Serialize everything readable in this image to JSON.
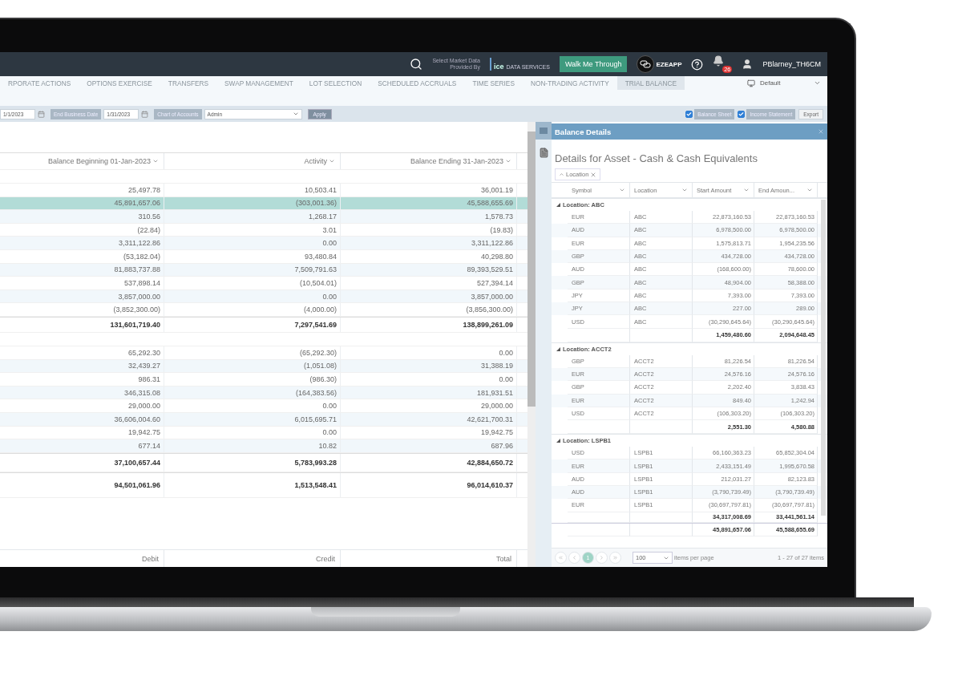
{
  "topbar": {
    "market_note": [
      "Select Market Data",
      "Provided By"
    ],
    "provider_logo": {
      "mark": "ice",
      "text": "DATA SERVICES"
    },
    "walk_button": "Walk Me Through",
    "app_name": "EZEAPP",
    "notifications": "26",
    "user": "PBlarney_TH6CM"
  },
  "tabs": [
    {
      "label": "RPORATE ACTIONS",
      "selected": false
    },
    {
      "label": "OPTIONS EXERCISE",
      "selected": false
    },
    {
      "label": "TRANSFERS",
      "selected": false
    },
    {
      "label": "SWAP MANAGEMENT",
      "selected": false
    },
    {
      "label": "LOT SELECTION",
      "selected": false
    },
    {
      "label": "SCHEDULED ACCRUALS",
      "selected": false
    },
    {
      "label": "TIME SERIES",
      "selected": false
    },
    {
      "label": "NON-TRADING ACTIVITY",
      "selected": false
    },
    {
      "label": "TRIAL BALANCE",
      "selected": true
    }
  ],
  "layout_menu": "Default",
  "filters": {
    "start_date": "1/1/2023",
    "end_label": "End Business Date",
    "end_date": "1/31/2023",
    "chart_label": "Chart of Accounts",
    "chart_value": "Admin",
    "apply": "Apply",
    "toggles": [
      {
        "label": "Balance Sheet",
        "checked": true
      },
      {
        "label": "Income Statement",
        "checked": true
      }
    ],
    "export": "Export"
  },
  "trial_balance": {
    "columns": [
      "Balance Beginning 01-Jan-2023",
      "Activity",
      "Balance Ending 31-Jan-2023"
    ],
    "rows": [
      {
        "kind": "blank"
      },
      {
        "kind": "row",
        "selected": false,
        "cells": [
          "25,497.78",
          "10,503.41",
          "36,001.19"
        ]
      },
      {
        "kind": "row",
        "selected": true,
        "cells": [
          "45,891,657.06",
          "(303,001.36)",
          "45,588,655.69"
        ]
      },
      {
        "kind": "row",
        "selected": false,
        "cells": [
          "310.56",
          "1,268.17",
          "1,578.73"
        ]
      },
      {
        "kind": "row",
        "selected": false,
        "cells": [
          "(22.84)",
          "3.01",
          "(19.83)"
        ]
      },
      {
        "kind": "row",
        "selected": false,
        "cells": [
          "3,311,122.86",
          "0.00",
          "3,311,122.86"
        ]
      },
      {
        "kind": "row",
        "selected": false,
        "cells": [
          "(53,182.04)",
          "93,480.84",
          "40,298.80"
        ]
      },
      {
        "kind": "row",
        "selected": false,
        "cells": [
          "81,883,737.88",
          "7,509,791.63",
          "89,393,529.51"
        ]
      },
      {
        "kind": "row",
        "selected": false,
        "cells": [
          "537,898.14",
          "(10,504.01)",
          "527,394.14"
        ]
      },
      {
        "kind": "row",
        "selected": false,
        "cells": [
          "3,857,000.00",
          "0.00",
          "3,857,000.00"
        ]
      },
      {
        "kind": "row",
        "selected": false,
        "cells": [
          "(3,852,300.00)",
          "(4,000.00)",
          "(3,856,300.00)"
        ]
      },
      {
        "kind": "total",
        "cells": [
          "131,601,719.40",
          "7,297,541.69",
          "138,899,261.09"
        ]
      },
      {
        "kind": "blank"
      },
      {
        "kind": "row",
        "selected": false,
        "cells": [
          "65,292.30",
          "(65,292.30)",
          "0.00"
        ]
      },
      {
        "kind": "row",
        "selected": false,
        "cells": [
          "32,439.27",
          "(1,051.08)",
          "31,388.19"
        ]
      },
      {
        "kind": "row",
        "selected": false,
        "cells": [
          "986.31",
          "(986.30)",
          "0.00"
        ]
      },
      {
        "kind": "row",
        "selected": false,
        "cells": [
          "346,315.08",
          "(164,383.56)",
          "181,931.51"
        ]
      },
      {
        "kind": "row",
        "selected": false,
        "cells": [
          "29,000.00",
          "0.00",
          "29,000.00"
        ]
      },
      {
        "kind": "row",
        "selected": false,
        "cells": [
          "36,606,004.60",
          "6,015,695.71",
          "42,621,700.31"
        ]
      },
      {
        "kind": "row",
        "selected": false,
        "cells": [
          "19,942.75",
          "0.00",
          "19,942.75"
        ]
      },
      {
        "kind": "row",
        "selected": false,
        "cells": [
          "677.14",
          "10.82",
          "687.96"
        ]
      },
      {
        "kind": "total",
        "cells": [
          "37,100,657.44",
          "5,783,993.28",
          "42,884,650.72"
        ]
      },
      {
        "kind": "grand",
        "cells": [
          "94,501,061.96",
          "1,513,548.41",
          "96,014,610.37"
        ]
      }
    ],
    "footer": [
      "Debit",
      "Credit",
      "Total"
    ]
  },
  "details": {
    "title": "Balance Details",
    "heading": "Details for Asset - Cash & Cash Equivalents",
    "group_chip": "Location",
    "columns": [
      "Symbol",
      "Location",
      "Start Amount",
      "End Amoun..."
    ],
    "groups": [
      {
        "label": "Location: ABC",
        "expanded": true,
        "rows": [
          [
            "EUR",
            "ABC",
            "22,873,160.53",
            "22,873,160.53"
          ],
          [
            "AUD",
            "ABC",
            "6,978,500.00",
            "6,978,500.00"
          ],
          [
            "EUR",
            "ABC",
            "1,575,813.71",
            "1,954,235.56"
          ],
          [
            "GBP",
            "ABC",
            "434,728.00",
            "434,728.00"
          ],
          [
            "AUD",
            "ABC",
            "(168,600.00)",
            "78,600.00"
          ],
          [
            "GBP",
            "ABC",
            "48,904.00",
            "58,388.00"
          ],
          [
            "JPY",
            "ABC",
            "7,393.00",
            "7,393.00"
          ],
          [
            "JPY",
            "ABC",
            "227.00",
            "289.00"
          ],
          [
            "USD",
            "ABC",
            "(30,290,645.64)",
            "(30,290,645.64)"
          ]
        ],
        "total": [
          "1,459,480.60",
          "2,094,648.45"
        ]
      },
      {
        "label": "Location: ACCT2",
        "expanded": true,
        "rows": [
          [
            "GBP",
            "ACCT2",
            "81,226.54",
            "81,226.54"
          ],
          [
            "EUR",
            "ACCT2",
            "24,576.16",
            "24,576.16"
          ],
          [
            "GBP",
            "ACCT2",
            "2,202.40",
            "3,838.43"
          ],
          [
            "EUR",
            "ACCT2",
            "849.40",
            "1,242.94"
          ],
          [
            "USD",
            "ACCT2",
            "(106,303.20)",
            "(106,303.20)"
          ]
        ],
        "total": [
          "2,551.30",
          "4,580.88"
        ]
      },
      {
        "label": "Location: LSPB1",
        "expanded": true,
        "rows": [
          [
            "USD",
            "LSPB1",
            "66,160,363.23",
            "65,852,304.04"
          ],
          [
            "EUR",
            "LSPB1",
            "2,433,151.49",
            "1,995,670.58"
          ],
          [
            "AUD",
            "LSPB1",
            "212,031.27",
            "82,123.83"
          ],
          [
            "AUD",
            "LSPB1",
            "(3,790,739.49)",
            "(3,790,739.49)"
          ],
          [
            "EUR",
            "LSPB1",
            "(30,697,797.81)",
            "(30,697,797.81)"
          ]
        ],
        "total": [
          "34,317,008.69",
          "33,441,561.14"
        ]
      }
    ],
    "grand_total": [
      "45,891,657.06",
      "45,588,655.69"
    ],
    "pager": {
      "pages": [
        {
          "label": "1",
          "selected": true
        }
      ],
      "page_size": "100",
      "page_size_label": "items per page",
      "range": "1 - 27 of 27 items"
    }
  }
}
